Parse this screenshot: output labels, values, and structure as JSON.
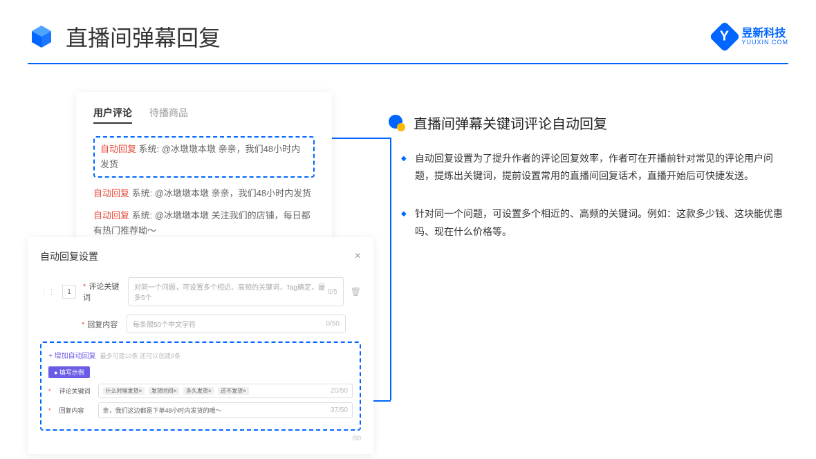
{
  "header": {
    "title": "直播间弹幕回复",
    "logo_cn": "昱新科技",
    "logo_en": "YUUXIN.COM",
    "logo_letter": "Y"
  },
  "comment_panel": {
    "tab_active": "用户评论",
    "tab_inactive": "待播商品",
    "highlighted": {
      "tag": "自动回复",
      "text": " 系统: @冰墩墩本墩 亲亲，我们48小时内发货"
    },
    "items": [
      {
        "tag": "自动回复",
        "text": " 系统: @冰墩墩本墩 亲亲，我们48小时内发货"
      },
      {
        "tag": "自动回复",
        "text": " 系统: @冰墩墩本墩 关注我们的店铺，每日都有热门推荐呦～"
      }
    ]
  },
  "settings": {
    "title": "自动回复设置",
    "idx": "1",
    "keyword_label": "评论关键词",
    "keyword_placeholder": "对同一个问题，可设置多个相近、高频的关键词，Tag确定，最多5个",
    "keyword_count": "0/5",
    "content_label": "回复内容",
    "content_placeholder": "每条限50个中文字符",
    "content_count": "0/50",
    "add_link": "+ 增加自动回复",
    "add_hint": "最多可建10条 还可以创建9条",
    "example_badge": "● 填写示例",
    "ex_keyword_label": "评论关键词",
    "ex_tags": [
      "什么时候发货×",
      "发货时间×",
      "多久发货×",
      "还不发货×"
    ],
    "ex_keyword_count": "20/50",
    "ex_content_label": "回复内容",
    "ex_content_value": "亲，我们这边都是下单48小时内发货的哦～",
    "ex_content_count": "37/50",
    "bottom_count": "/50"
  },
  "right": {
    "heading": "直播间弹幕关键词评论自动回复",
    "bullets": [
      "自动回复设置为了提升作者的评论回复效率，作者可在开播前针对常见的评论用户问题，提炼出关键词，提前设置常用的直播间回复话术，直播开始后可快捷发送。",
      "针对同一个问题，可设置多个相近的、高频的关键词。例如：这款多少钱、这块能优惠吗、现在什么价格等。"
    ]
  }
}
